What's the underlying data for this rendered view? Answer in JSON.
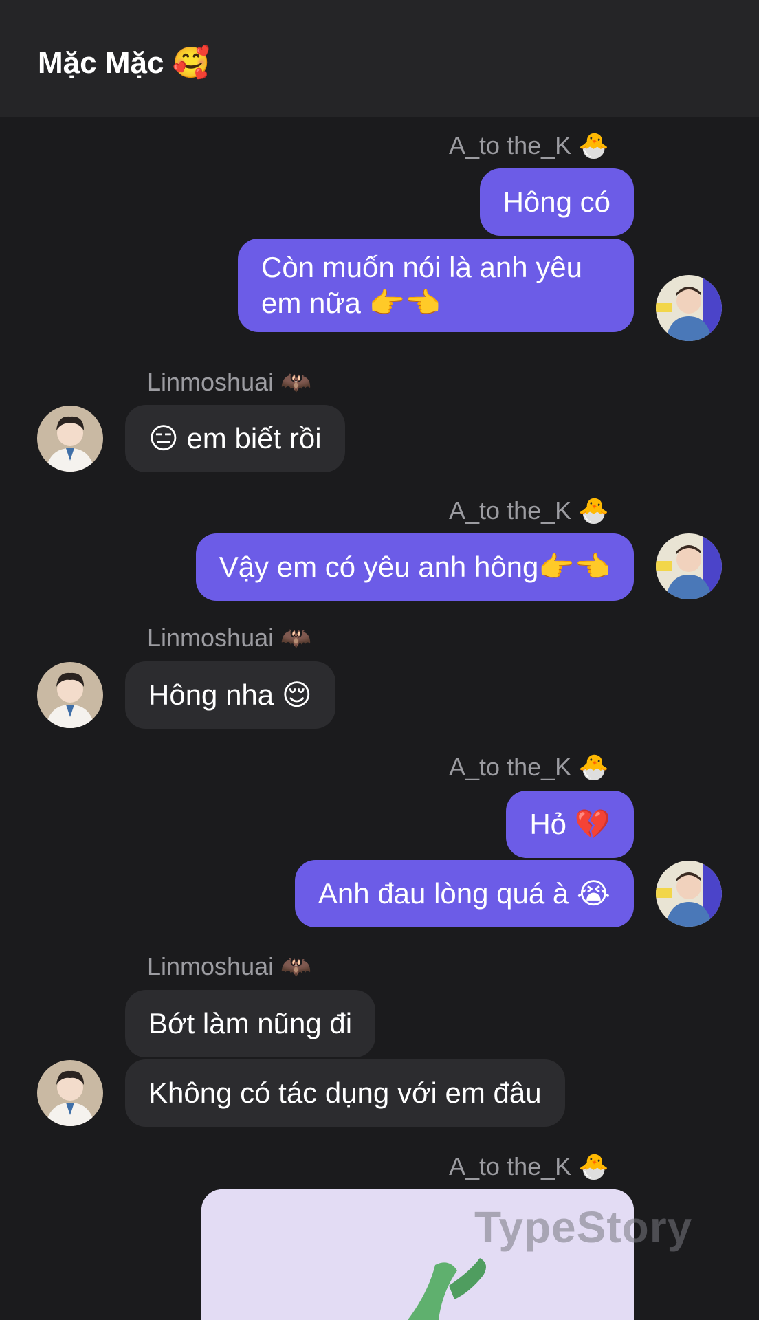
{
  "header": {
    "title": "Mặc Mặc",
    "title_emoji": "🥰"
  },
  "participants": {
    "me": {
      "name": "A_to the_K",
      "emoji": "🐣"
    },
    "them": {
      "name": "Linmoshuai",
      "emoji": "🦇"
    }
  },
  "messages": [
    {
      "text": "Hông có"
    },
    {
      "text": "Còn muốn nói là anh yêu em nữa 👉👈"
    },
    {
      "text": "😑 em biết rồi"
    },
    {
      "text": "Vậy em có yêu anh hông👉👈"
    },
    {
      "text": "Hông nha 😌"
    },
    {
      "text": "Hỏ 💔"
    },
    {
      "text": "Anh đau lòng quá à 😭"
    },
    {
      "text": "Bớt làm nũng đi"
    },
    {
      "text": "Không có tác dụng với em đâu"
    }
  ],
  "watermark": "TypeStory",
  "colors": {
    "background": "#1b1b1d",
    "header_bg": "#252527",
    "my_bubble": "#6c5ce7",
    "their_bubble": "#2c2c2f",
    "sender_name": "#9c9ca1"
  }
}
